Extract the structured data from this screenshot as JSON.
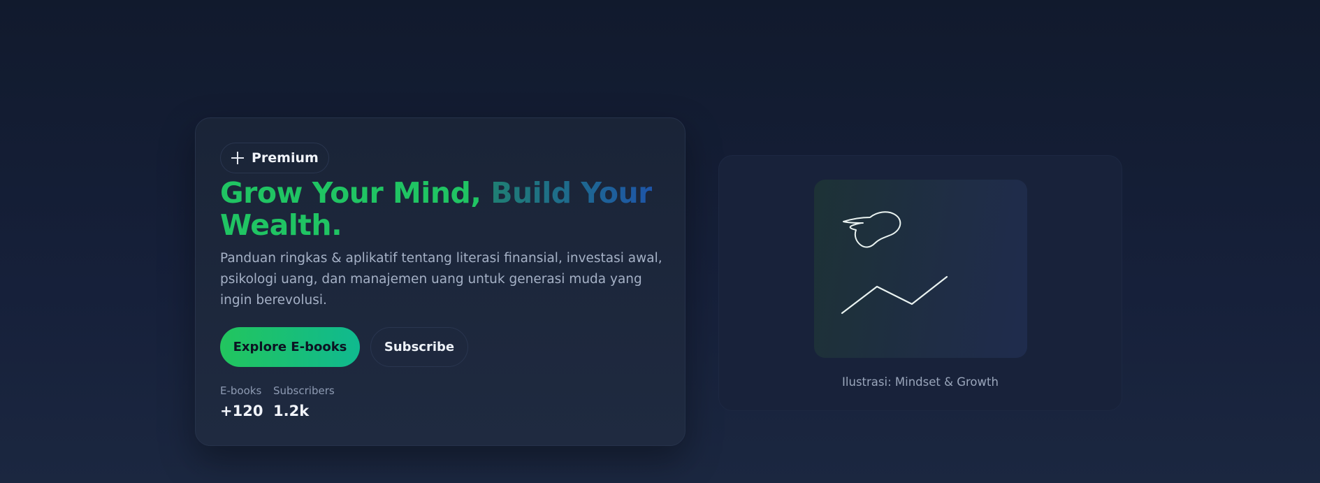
{
  "hero": {
    "badge_label": "Premium",
    "headline_part1": "Grow Your Mind,",
    "headline_part2": "Build Your",
    "headline_part3": "Wealth.",
    "description": "Panduan ringkas & aplikatif tentang literasi finansial, investasi awal, psikologi uang, dan manajemen uang untuk generasi muda yang ingin berevolusi.",
    "primary_button": "Explore E-books",
    "secondary_button": "Subscribe",
    "stats": [
      {
        "label": "E-books",
        "value": "+120"
      },
      {
        "label": "Subscribers",
        "value": "1.2k"
      }
    ]
  },
  "illustration": {
    "caption": "Ilustrasi: Mindset & Growth",
    "icon": "brain-and-growth-line"
  },
  "colors": {
    "accent_green": "#22c55e",
    "accent_teal": "#10b98f",
    "accent_blue": "#1e55a8",
    "background": "#111a2d",
    "card": "#1a2437"
  }
}
